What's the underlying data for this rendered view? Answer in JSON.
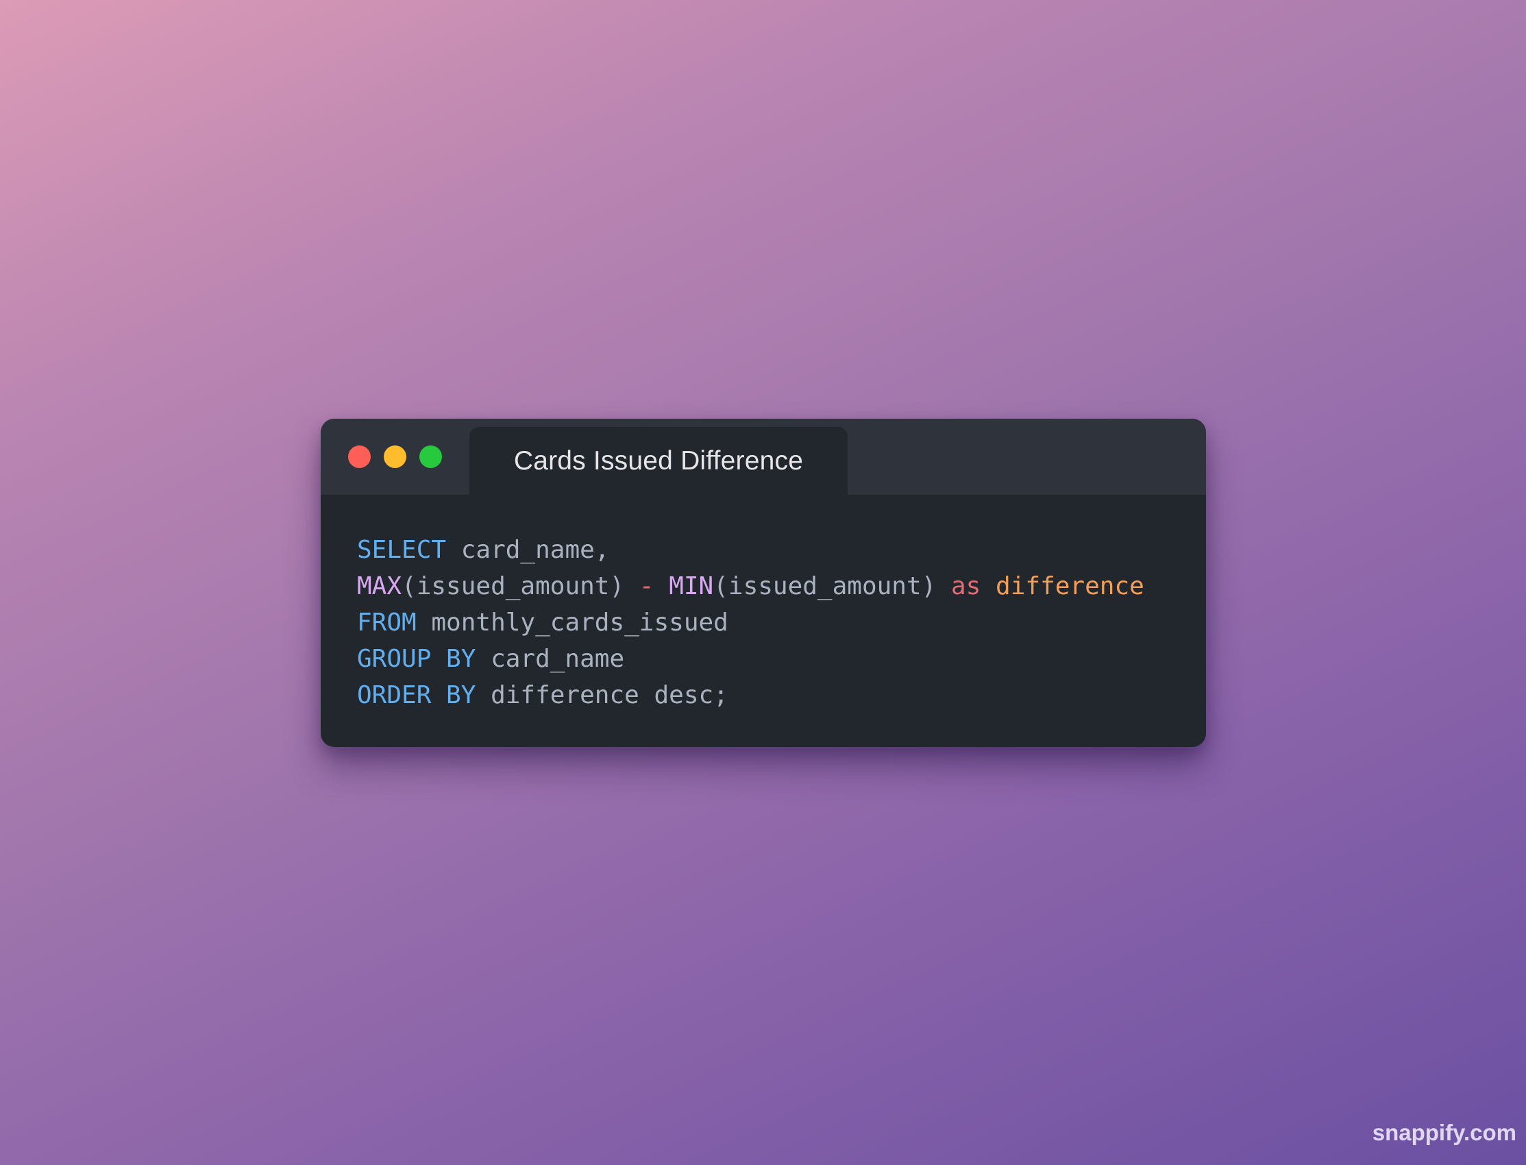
{
  "window": {
    "tab_title": "Cards Issued Difference",
    "controls": {
      "close_color": "#ff5f56",
      "minimize_color": "#ffbd2e",
      "maximize_color": "#27c93f"
    }
  },
  "code": {
    "language": "sql",
    "lines": [
      [
        {
          "t": "SELECT",
          "k": "kw"
        },
        {
          "t": " card_name,",
          "k": "plain"
        }
      ],
      [
        {
          "t": "MAX",
          "k": "fn"
        },
        {
          "t": "(issued_amount) ",
          "k": "plain"
        },
        {
          "t": "-",
          "k": "op"
        },
        {
          "t": " ",
          "k": "plain"
        },
        {
          "t": "MIN",
          "k": "fn"
        },
        {
          "t": "(issued_amount) ",
          "k": "plain"
        },
        {
          "t": "as",
          "k": "as"
        },
        {
          "t": " ",
          "k": "plain"
        },
        {
          "t": "difference",
          "k": "alias"
        }
      ],
      [
        {
          "t": "FROM",
          "k": "kw"
        },
        {
          "t": " monthly_cards_issued",
          "k": "plain"
        }
      ],
      [
        {
          "t": "GROUP BY",
          "k": "kw"
        },
        {
          "t": " card_name",
          "k": "plain"
        }
      ],
      [
        {
          "t": "ORDER BY",
          "k": "kw"
        },
        {
          "t": " difference desc;",
          "k": "plain"
        }
      ]
    ]
  },
  "watermark": "snappify.com"
}
